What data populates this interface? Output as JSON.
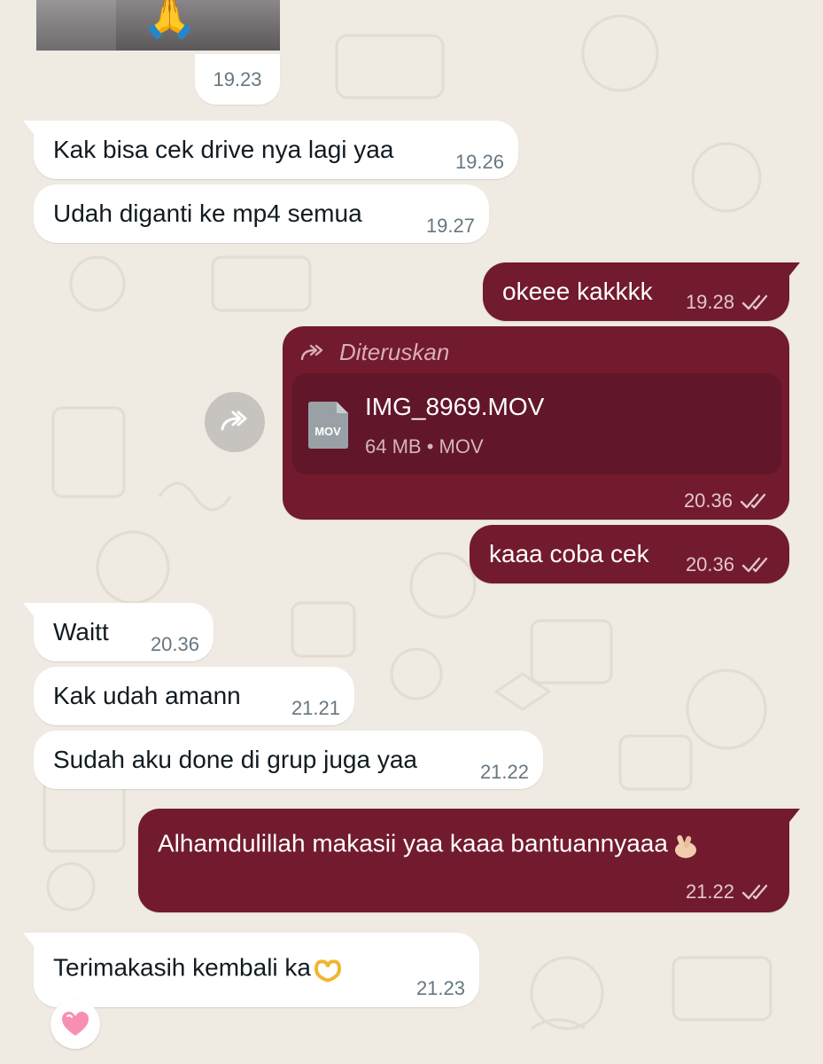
{
  "chat": {
    "top_time": "19.23",
    "photo_emoji": "🙏",
    "messages": [
      {
        "direction": "incoming",
        "text": "Kak bisa cek drive nya lagi yaa",
        "time": "19.26"
      },
      {
        "direction": "incoming",
        "text": "Udah diganti ke mp4 semua",
        "time": "19.27"
      },
      {
        "direction": "outgoing",
        "text": "okeee kakkkk",
        "time": "19.28",
        "status": "read"
      },
      {
        "direction": "outgoing",
        "forwarded_label": "Diteruskan",
        "document": {
          "icon": "mov-file-icon",
          "icon_label": "MOV",
          "name": "IMG_8969.MOV",
          "info": "64 MB • MOV"
        },
        "time": "20.36",
        "status": "read"
      },
      {
        "direction": "outgoing",
        "text": "kaaa coba cek",
        "time": "20.36",
        "status": "read"
      },
      {
        "direction": "incoming",
        "text": "Waitt",
        "time": "20.36"
      },
      {
        "direction": "incoming",
        "text": "Kak udah amann",
        "time": "21.21"
      },
      {
        "direction": "incoming",
        "text": "Sudah aku done di grup juga yaa",
        "time": "21.22"
      },
      {
        "direction": "outgoing",
        "text": "Alhamdulillah makasii yaa kaaa bantuannyaaa",
        "emoji": "🫰",
        "time": "21.22",
        "status": "read"
      },
      {
        "direction": "incoming",
        "text": "Terimakasih kembali ka",
        "emoji": "🫶",
        "time": "21.23",
        "reaction": "💗"
      }
    ]
  },
  "colors": {
    "background": "#efeae2",
    "incoming_bubble": "#ffffff",
    "outgoing_bubble": "#721a2e",
    "document_card": "#611629",
    "forwarded_text": "#d9aeb9",
    "time_incoming": "#667781",
    "time_outgoing": "#e1c6cd"
  }
}
